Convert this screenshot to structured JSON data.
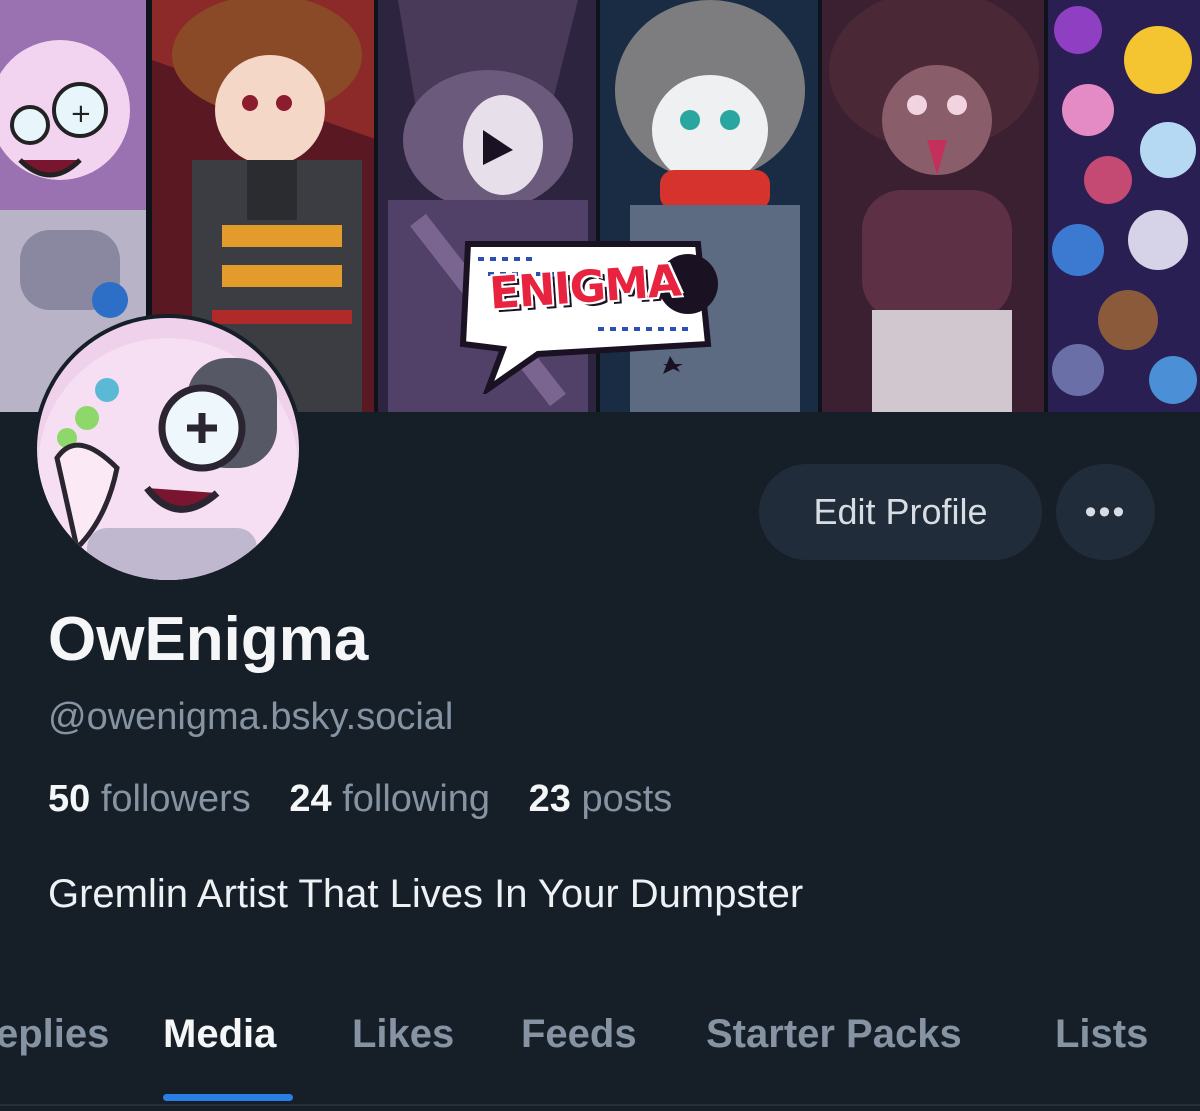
{
  "banner": {
    "logo_text": "ENIGMA"
  },
  "actions": {
    "edit_profile": "Edit Profile",
    "more": "•••"
  },
  "profile": {
    "display_name": "OwEnigma",
    "handle": "@owenigma.bsky.social",
    "bio": "Gremlin Artist That Lives In Your Dumpster"
  },
  "stats": {
    "followers_count": "50",
    "followers_label": "followers",
    "following_count": "24",
    "following_label": "following",
    "posts_count": "23",
    "posts_label": "posts"
  },
  "tabs": [
    {
      "label": "eplies",
      "active": false
    },
    {
      "label": "Media",
      "active": true
    },
    {
      "label": "Likes",
      "active": false
    },
    {
      "label": "Feeds",
      "active": false
    },
    {
      "label": "Starter Packs",
      "active": false
    },
    {
      "label": "Lists",
      "active": false
    }
  ],
  "colors": {
    "background": "#161e27",
    "button": "#202c39",
    "accent": "#2a7fe6",
    "muted_text": "#8593a3"
  }
}
